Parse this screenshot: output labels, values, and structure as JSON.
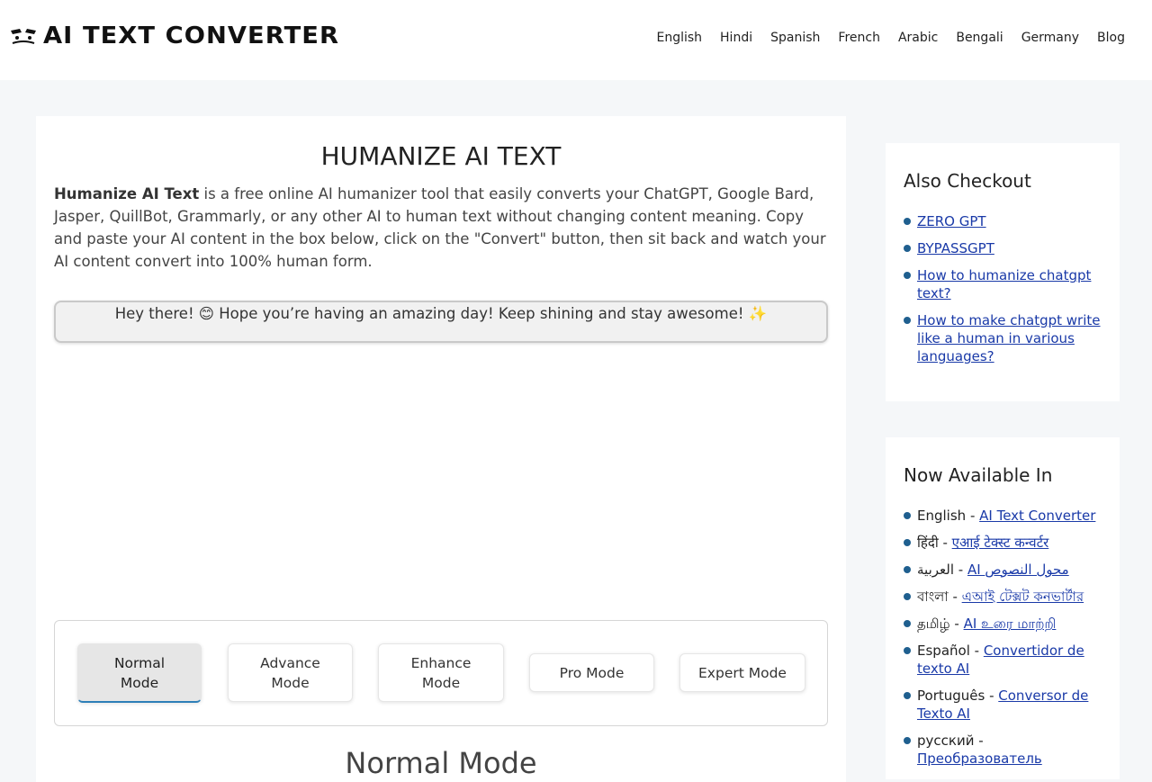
{
  "header": {
    "logo_text": "AI TEXT CONVERTER",
    "nav": [
      "English",
      "Hindi",
      "Spanish",
      "French",
      "Arabic",
      "Bengali",
      "Germany",
      "Blog"
    ]
  },
  "main": {
    "title": "HUMANIZE AI TEXT",
    "intro_bold": "Humanize AI Text",
    "intro_rest": " is a free online AI humanizer tool that easily converts your ChatGPT, Google Bard, Jasper, QuillBot, Grammarly, or any other AI to human text without changing content meaning. Copy and paste your AI content in the box below, click on the \"Convert\" button, then sit back and watch your AI content convert into 100% human form.",
    "greeting": "Hey there! 😊 Hope you’re having an amazing day! Keep shining and stay awesome! ✨",
    "modes": [
      "Normal Mode",
      "Advance Mode",
      "Enhance Mode",
      "Pro Mode",
      "Expert Mode"
    ],
    "active_mode": "Normal Mode",
    "mode_heading": "Normal Mode"
  },
  "sidebar": {
    "also_checkout": {
      "title": "Also Checkout",
      "links": [
        "ZERO GPT",
        "BYPASSGPT",
        "How to humanize chatgpt text?",
        "How to make chatgpt write like a human in various languages?"
      ]
    },
    "available_in": {
      "title": "Now Available In",
      "items": [
        {
          "lang": "English",
          "link": "AI Text Converter"
        },
        {
          "lang": "हिंदी",
          "link": "एआई टेक्स्ट कन्वर्टर"
        },
        {
          "lang": "العربية",
          "link": "AI محول النصوص"
        },
        {
          "lang": "বাংলা",
          "link": "এআই টেক্সট কনভার্টার"
        },
        {
          "lang": "தமிழ்",
          "link": "AI உரை மாற்றி"
        },
        {
          "lang": "Español",
          "link": "Convertidor de texto AI"
        },
        {
          "lang": "Português",
          "link": "Conversor de Texto AI"
        },
        {
          "lang": "русский",
          "link": "Преобразователь"
        }
      ]
    }
  },
  "colors": {
    "page_bg": "#f5f7f9",
    "link": "#1a3aa8",
    "bullet": "#1f5f8f",
    "active_mode_bg": "#e6e6e6",
    "active_mode_accent": "#2d7fb8"
  }
}
